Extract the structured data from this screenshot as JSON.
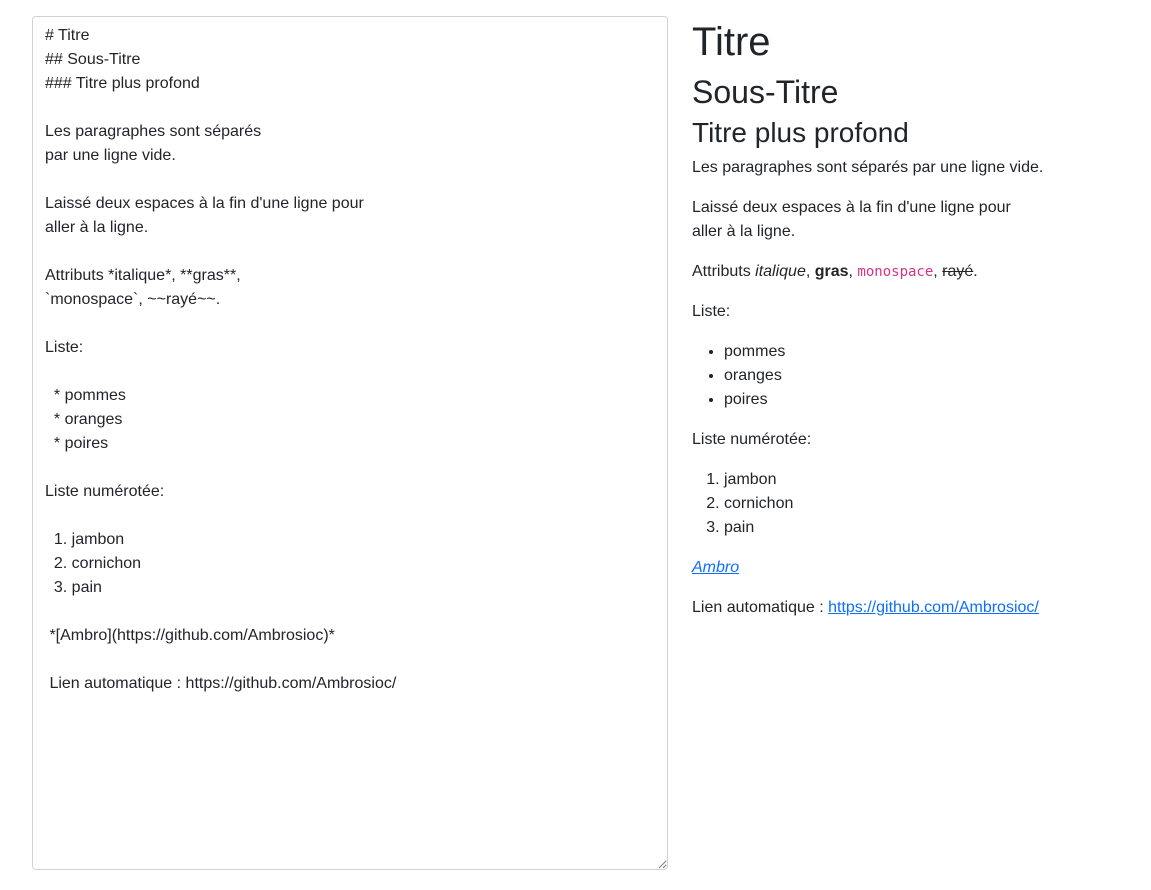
{
  "editor": {
    "source": "# Titre\n## Sous-Titre\n### Titre plus profond\n\nLes paragraphes sont séparés\npar une ligne vide.\n\nLaissé deux espaces à la fin d'une ligne pour\naller à la ligne.\n\nAttributs *italique*, **gras**,\n`monospace`, ~~rayé~~.\n\nListe:\n\n  * pommes\n  * oranges\n  * poires\n\nListe numérotée:\n\n  1. jambon\n  2. cornichon\n  3. pain\n\n *[Ambro](https://github.com/Ambrosioc)*\n\n Lien automatique : https://github.com/Ambrosioc/"
  },
  "preview": {
    "h1": "Titre",
    "h2": "Sous-Titre",
    "h3": "Titre plus profond",
    "paragraph1": "Les paragraphes sont séparés par une ligne vide.",
    "paragraph2_line1": "Laissé deux espaces à la fin d'une ligne pour",
    "paragraph2_line2": "aller à la ligne.",
    "attributes": {
      "prefix": "Attributs ",
      "italic": "italique",
      "sep1": ", ",
      "bold": "gras",
      "sep2": ", ",
      "mono": "monospace",
      "sep3": ", ",
      "strike": "rayé",
      "suffix": "."
    },
    "list_label": "Liste:",
    "bullet_items": [
      "pommes",
      "oranges",
      "poires"
    ],
    "numbered_label": "Liste numérotée:",
    "numbered_items": [
      "jambon",
      "cornichon",
      "pain"
    ],
    "link_text": "Ambro",
    "autolink_prefix": "Lien automatique : ",
    "autolink_url": "https://github.com/Ambrosioc/"
  }
}
